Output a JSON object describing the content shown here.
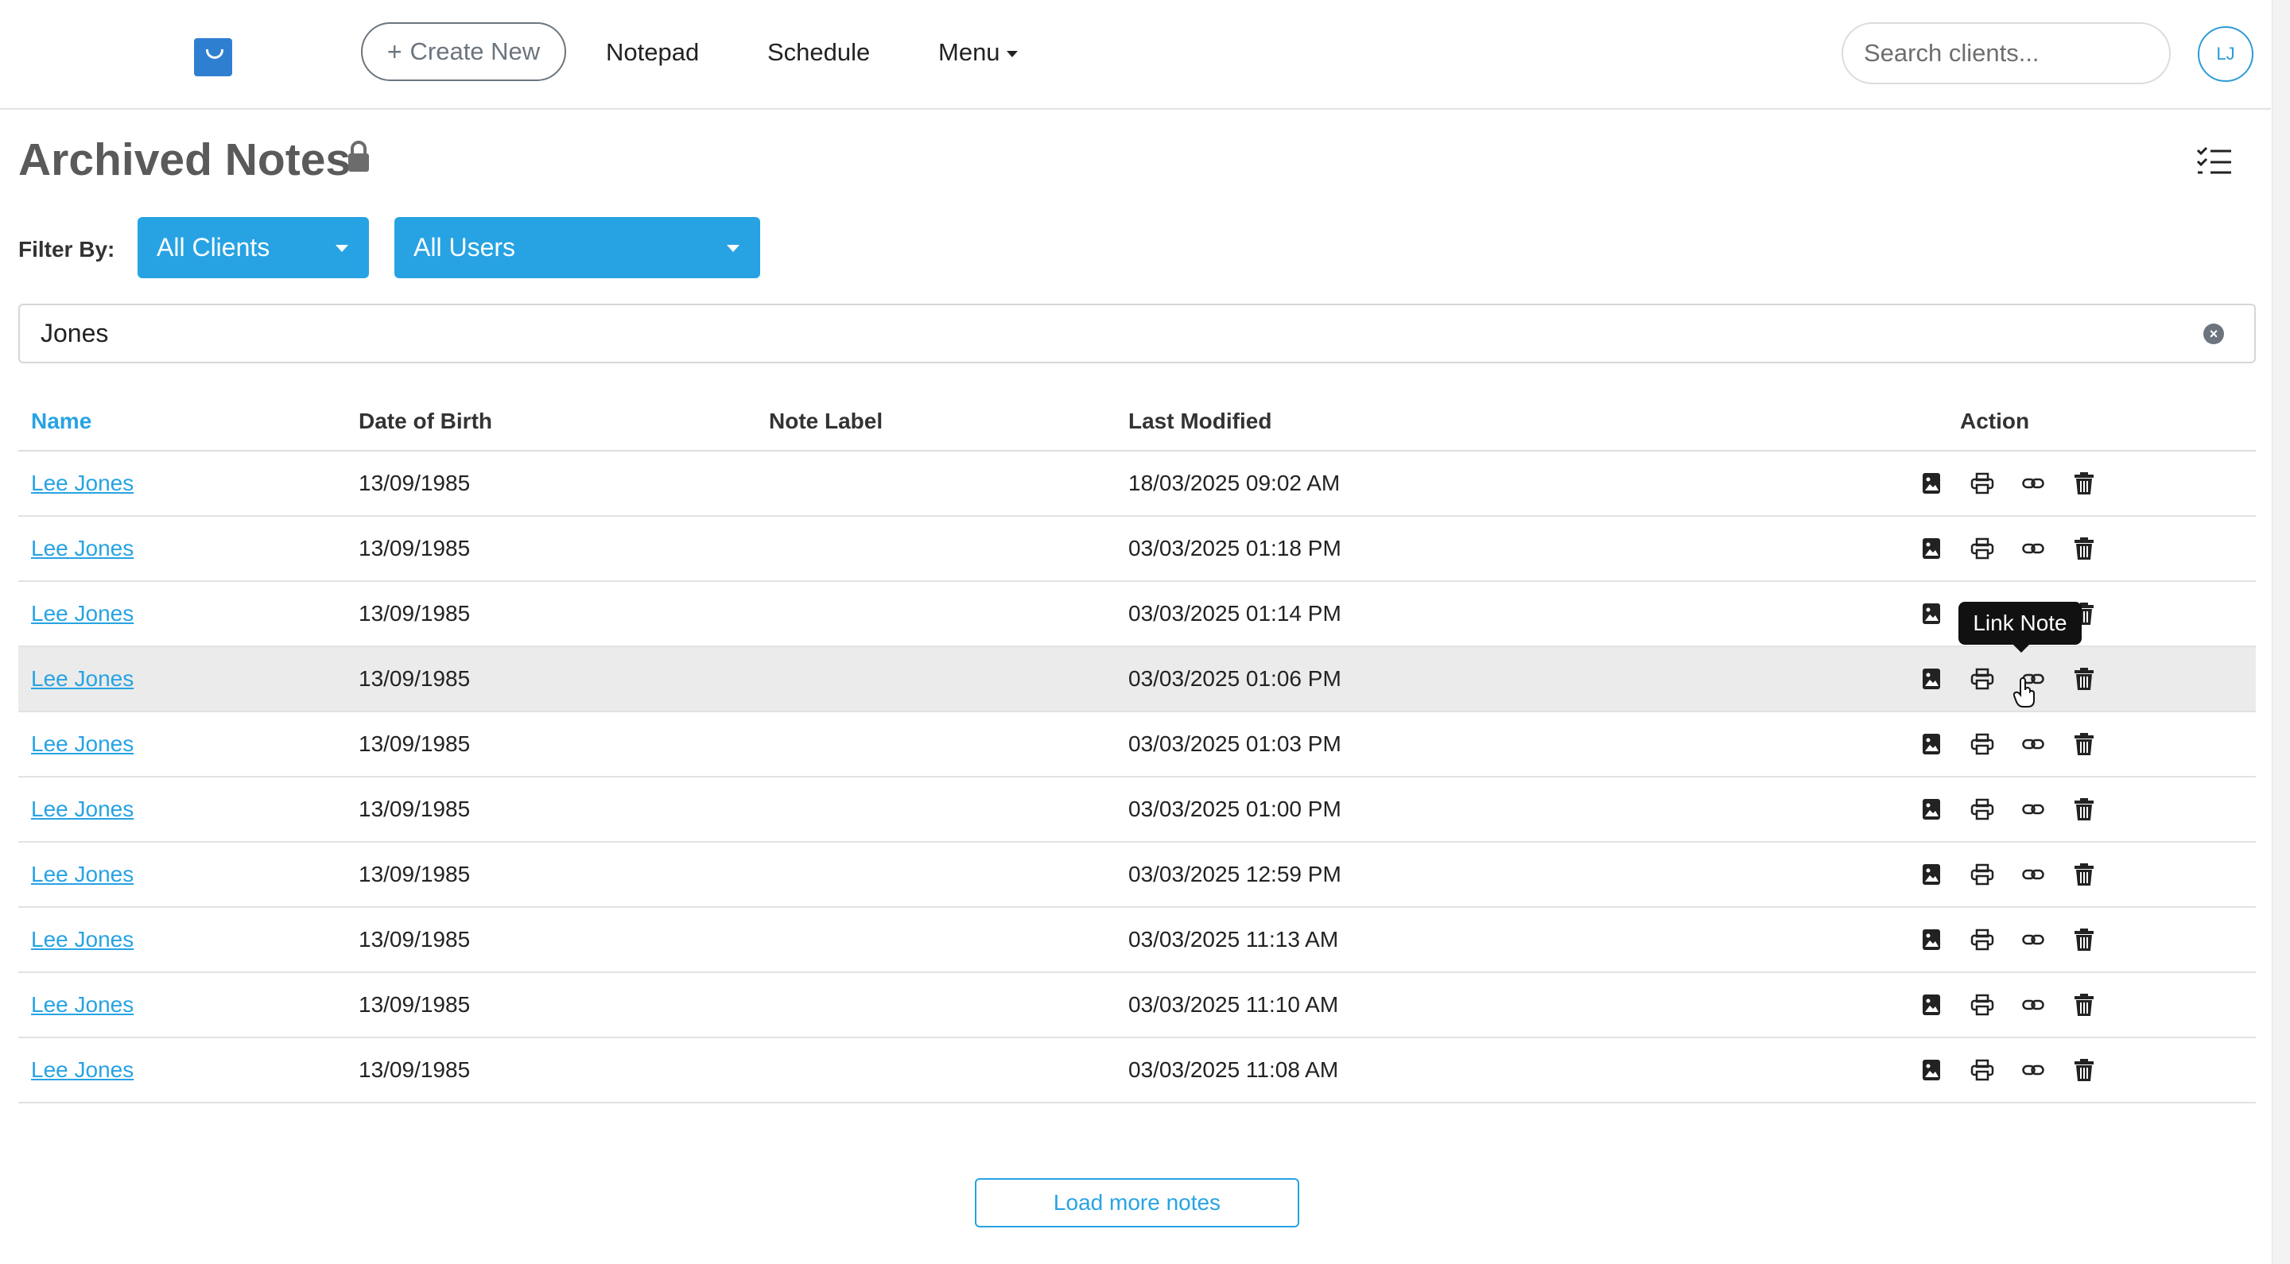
{
  "nav": {
    "create_label": "Create New",
    "create_icon": "plus-icon",
    "notepad": "Notepad",
    "schedule": "Schedule",
    "menu": "Menu",
    "search_placeholder": "Search clients...",
    "avatar_initials": "LJ"
  },
  "page": {
    "title": "Archived Notes",
    "filter_label": "Filter By:",
    "clients_filter": "All Clients",
    "users_filter": "All Users",
    "search_value": "Jones"
  },
  "table": {
    "headers": {
      "name": "Name",
      "dob": "Date of Birth",
      "note_label": "Note Label",
      "last_modified": "Last Modified",
      "action": "Action"
    },
    "rows": [
      {
        "name": "Lee Jones",
        "dob": "13/09/1985",
        "label": "",
        "modified": "18/03/2025 09:02 AM"
      },
      {
        "name": "Lee Jones",
        "dob": "13/09/1985",
        "label": "",
        "modified": "03/03/2025 01:18 PM"
      },
      {
        "name": "Lee Jones",
        "dob": "13/09/1985",
        "label": "",
        "modified": "03/03/2025 01:14 PM"
      },
      {
        "name": "Lee Jones",
        "dob": "13/09/1985",
        "label": "",
        "modified": "03/03/2025 01:06 PM"
      },
      {
        "name": "Lee Jones",
        "dob": "13/09/1985",
        "label": "",
        "modified": "03/03/2025 01:03 PM"
      },
      {
        "name": "Lee Jones",
        "dob": "13/09/1985",
        "label": "",
        "modified": "03/03/2025 01:00 PM"
      },
      {
        "name": "Lee Jones",
        "dob": "13/09/1985",
        "label": "",
        "modified": "03/03/2025 12:59 PM"
      },
      {
        "name": "Lee Jones",
        "dob": "13/09/1985",
        "label": "",
        "modified": "03/03/2025 11:13 AM"
      },
      {
        "name": "Lee Jones",
        "dob": "13/09/1985",
        "label": "",
        "modified": "03/03/2025 11:10 AM"
      },
      {
        "name": "Lee Jones",
        "dob": "13/09/1985",
        "label": "",
        "modified": "03/03/2025 11:08 AM"
      }
    ],
    "action_icons": [
      "image-icon",
      "print-icon",
      "link-icon",
      "trash-icon"
    ],
    "hovered_row": 4
  },
  "tooltip": "Link Note",
  "load_more": "Load more notes",
  "colors": {
    "accent": "#27a3e3",
    "logo": "#2f7fd1",
    "hover_row": "#ebebeb",
    "tooltip_bg": "#111111"
  }
}
